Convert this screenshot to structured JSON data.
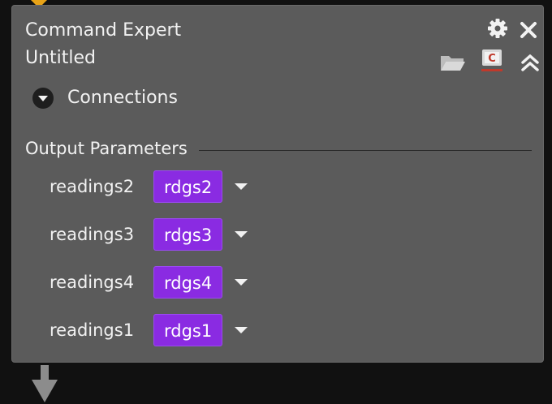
{
  "colors": {
    "panel_bg": "#5b5b5b",
    "background": "#111111",
    "chip_purple": "#8a2be2",
    "accent_orange": "#e8a317",
    "text": "#f2f2f2"
  },
  "node": {
    "title": "Command Expert",
    "subtitle": "Untitled"
  },
  "icons": {
    "settings": "gear-icon",
    "close": "close-icon",
    "open": "folder-icon",
    "instrument": "instrument-icon",
    "collapse": "double-chevron-up-icon",
    "expand_connections": "chevron-down-disc-icon",
    "dropdown": "caret-down-icon"
  },
  "connections": {
    "label": "Connections"
  },
  "output_parameters": {
    "title": "Output Parameters",
    "rows": [
      {
        "label": "readings2",
        "value": "rdgs2"
      },
      {
        "label": "readings3",
        "value": "rdgs3"
      },
      {
        "label": "readings4",
        "value": "rdgs4"
      },
      {
        "label": "readings1",
        "value": "rdgs1"
      }
    ]
  }
}
